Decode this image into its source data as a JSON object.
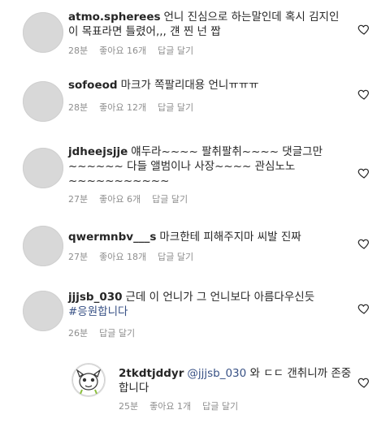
{
  "comments": [
    {
      "username": "atmo.spherees",
      "text": "언니 진심으로 하는말인데 혹시 김지인이 목표라면 틀렸어,,, 걘 찐 넌 짭",
      "time": "28분",
      "likes": "좋아요 16개",
      "reply": "답글 달기",
      "heart": "heart-outline"
    },
    {
      "username": "sofoeod",
      "text": "마크가 쪽팔리대용 언니ㅠㅠㅠ",
      "time": "28분",
      "likes": "좋아요 12개",
      "reply": "답글 달기",
      "heart": "heart-outline"
    },
    {
      "username": "jdheejsjje",
      "text": "얘두라~~~~ 팔취팔취~~~~ 댓글그만~~~~~~ 다들 앨범이나 사장~~~~ 관심노노~~~~~~~~~~~",
      "time": "27분",
      "likes": "좋아요 6개",
      "reply": "답글 달기",
      "heart": "heart-outline"
    },
    {
      "username": "qwermnbv___s",
      "text": "마크한테 피해주지마 씨발 진짜",
      "time": "27분",
      "likes": "좋아요 18개",
      "reply": "답글 달기",
      "heart": "heart-outline"
    },
    {
      "username": "jjjsb_030",
      "text": "근데 이 언니가 그 언니보다 아름다우신듯",
      "hashtag": "#응원합니다",
      "time": "26분",
      "reply": "답글 달기",
      "heart": "heart-outline"
    }
  ],
  "reply": {
    "username": "2tkdtjddyr",
    "mention": "@jjjsb_030",
    "text": "와 ㄷㄷ 갠취니까 존중합니다",
    "time": "25분",
    "likes": "좋아요 1개",
    "reply": "답글 달기",
    "heart": "heart-outline"
  }
}
